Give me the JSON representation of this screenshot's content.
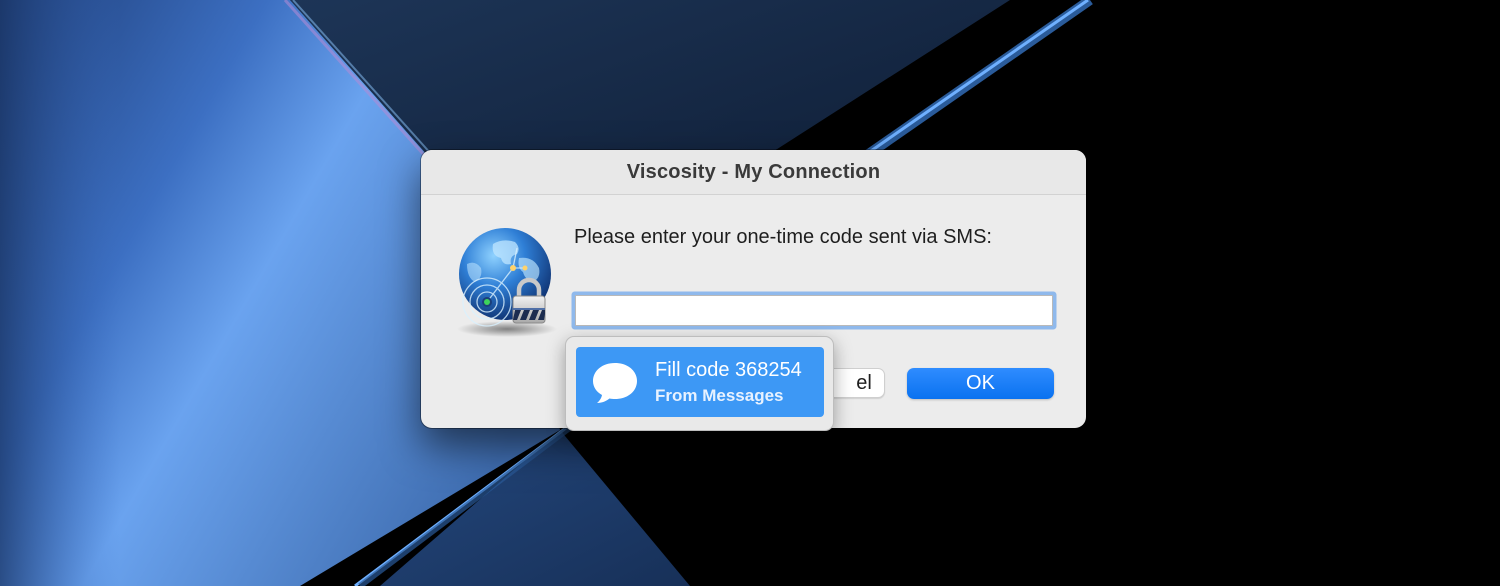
{
  "window": {
    "title": "Viscosity - My Connection"
  },
  "dialog": {
    "prompt": "Please enter your one-time code sent via SMS:",
    "input_value": "",
    "cancel_label": "el",
    "ok_label": "OK",
    "app_icon": "viscosity-globe-lock-icon"
  },
  "autofill": {
    "title": "Fill code 368254",
    "source": "From Messages",
    "icon": "message-bubble-icon"
  },
  "colors": {
    "accent": "#0a72f0",
    "suggestion_bg": "#3d98f5",
    "dialog_bg": "#ececec"
  }
}
